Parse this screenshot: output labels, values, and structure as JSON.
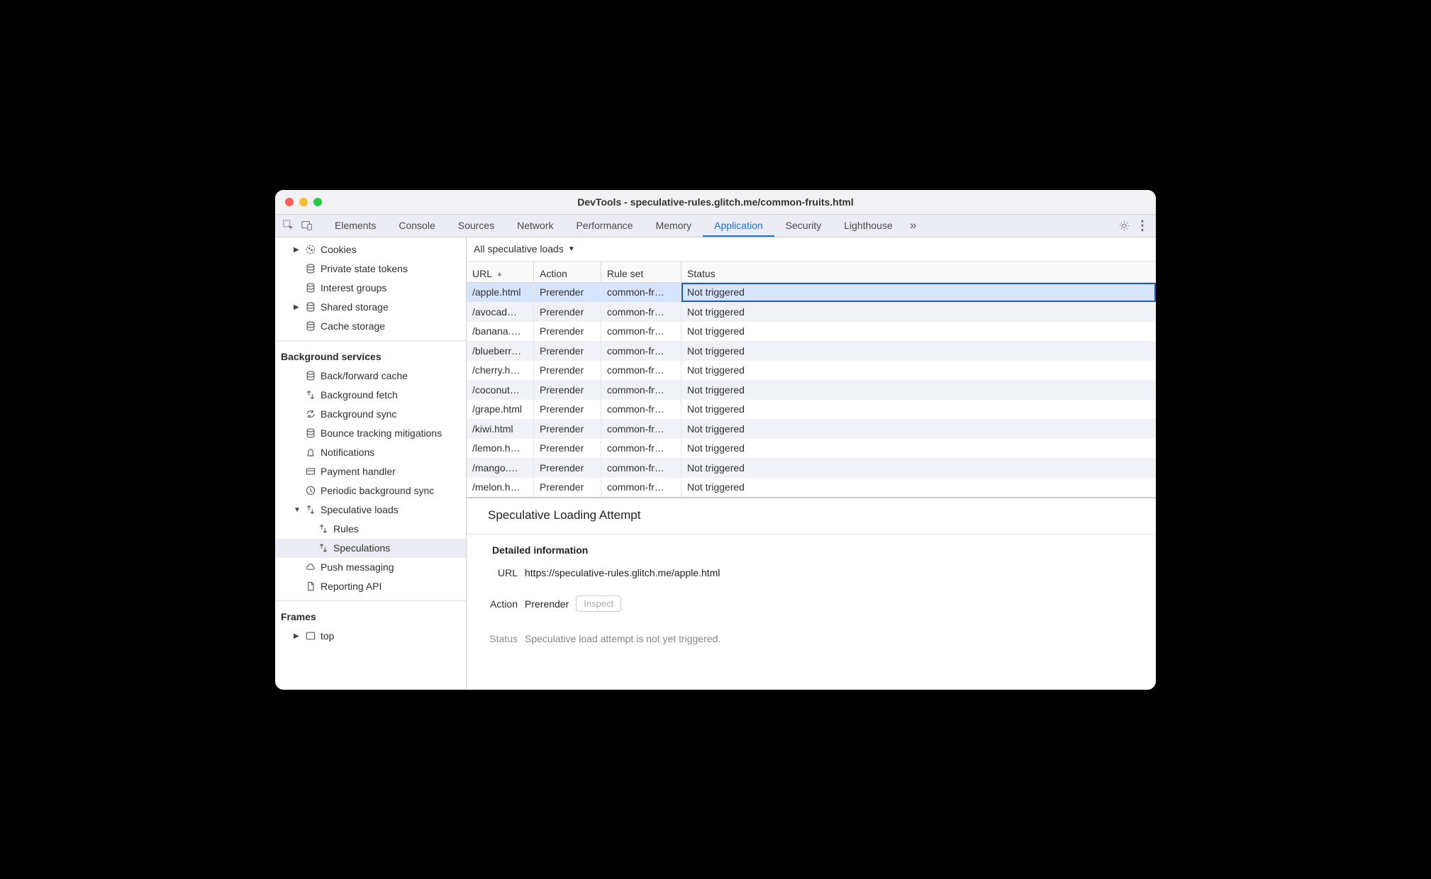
{
  "window_title": "DevTools - speculative-rules.glitch.me/common-fruits.html",
  "tabs": [
    "Elements",
    "Console",
    "Sources",
    "Network",
    "Performance",
    "Memory",
    "Application",
    "Security",
    "Lighthouse"
  ],
  "active_tab": "Application",
  "sidebar": {
    "storage": [
      {
        "icon": "cookie",
        "label": "Cookies",
        "expandable": true
      },
      {
        "icon": "db",
        "label": "Private state tokens"
      },
      {
        "icon": "db",
        "label": "Interest groups"
      },
      {
        "icon": "db",
        "label": "Shared storage",
        "expandable": true
      },
      {
        "icon": "db",
        "label": "Cache storage"
      }
    ],
    "bg_title": "Background services",
    "bg": [
      {
        "icon": "db",
        "label": "Back/forward cache"
      },
      {
        "icon": "fetch",
        "label": "Background fetch"
      },
      {
        "icon": "sync",
        "label": "Background sync"
      },
      {
        "icon": "db",
        "label": "Bounce tracking mitigations"
      },
      {
        "icon": "bell",
        "label": "Notifications"
      },
      {
        "icon": "card",
        "label": "Payment handler"
      },
      {
        "icon": "clock",
        "label": "Periodic background sync"
      },
      {
        "icon": "fetch",
        "label": "Speculative loads",
        "expandable": true,
        "expanded": true,
        "children": [
          {
            "icon": "fetch",
            "label": "Rules"
          },
          {
            "icon": "fetch",
            "label": "Speculations",
            "selected": true
          }
        ]
      },
      {
        "icon": "cloud",
        "label": "Push messaging"
      },
      {
        "icon": "file",
        "label": "Reporting API"
      }
    ],
    "frames_title": "Frames",
    "frames": [
      {
        "icon": "frame",
        "label": "top",
        "expandable": true
      }
    ]
  },
  "filter_label": "All speculative loads",
  "columns": [
    "URL",
    "Action",
    "Rule set",
    "Status"
  ],
  "rows": [
    {
      "url": "/apple.html",
      "action": "Prerender",
      "rule": "common-fr…",
      "status": "Not triggered",
      "selected": true
    },
    {
      "url": "/avocad…",
      "action": "Prerender",
      "rule": "common-fr…",
      "status": "Not triggered"
    },
    {
      "url": "/banana.…",
      "action": "Prerender",
      "rule": "common-fr…",
      "status": "Not triggered"
    },
    {
      "url": "/blueberr…",
      "action": "Prerender",
      "rule": "common-fr…",
      "status": "Not triggered"
    },
    {
      "url": "/cherry.h…",
      "action": "Prerender",
      "rule": "common-fr…",
      "status": "Not triggered"
    },
    {
      "url": "/coconut…",
      "action": "Prerender",
      "rule": "common-fr…",
      "status": "Not triggered"
    },
    {
      "url": "/grape.html",
      "action": "Prerender",
      "rule": "common-fr…",
      "status": "Not triggered"
    },
    {
      "url": "/kiwi.html",
      "action": "Prerender",
      "rule": "common-fr…",
      "status": "Not triggered"
    },
    {
      "url": "/lemon.h…",
      "action": "Prerender",
      "rule": "common-fr…",
      "status": "Not triggered"
    },
    {
      "url": "/mango.…",
      "action": "Prerender",
      "rule": "common-fr…",
      "status": "Not triggered"
    },
    {
      "url": "/melon.h…",
      "action": "Prerender",
      "rule": "common-fr…",
      "status": "Not triggered"
    }
  ],
  "details": {
    "title": "Speculative Loading Attempt",
    "section": "Detailed information",
    "url_label": "URL",
    "url": "https://speculative-rules.glitch.me/apple.html",
    "action_label": "Action",
    "action": "Prerender",
    "inspect": "Inspect",
    "status_label": "Status",
    "status": "Speculative load attempt is not yet triggered."
  }
}
